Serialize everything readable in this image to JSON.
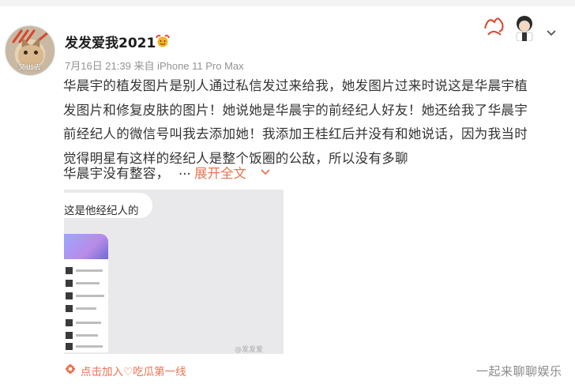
{
  "post": {
    "avatar_caption": "又出去",
    "username": "发发爱我2021",
    "meta": "7月16日 21:39 来自 iPhone 11 Pro Max",
    "text_lines": [
      "华晨宇的植发图片是别人通过私信发过来给我，她发图片过来时说这是华晨宇植",
      "发图片和修复皮肤的图片！她说她是华晨宇的前经纪人好友！她还给我了华晨宇",
      "前经纪人的微信号叫我去添加她！我添加王桂红后并没有和她说话，因为我当时",
      "觉得明星有这样的经纪人是整个饭圈的公敌，所以没有多聊"
    ],
    "truncated_line": "华晨宇没有整容，",
    "ellipsis": "...",
    "expand_label": "展开全文"
  },
  "image": {
    "bubble_text": "这是他经纪人的",
    "watermark": "@发发爱"
  },
  "footer": {
    "link_label": "点击加入♡吃瓜第一线",
    "watermark": "一起来聊聊娱乐"
  },
  "colors": {
    "accent": "#eb7350",
    "meta_gray": "#939393",
    "text": "#333333"
  },
  "icons": [
    "badge-icon",
    "dropdown-chevron-icon",
    "expand-chevron-icon",
    "flower-icon"
  ]
}
